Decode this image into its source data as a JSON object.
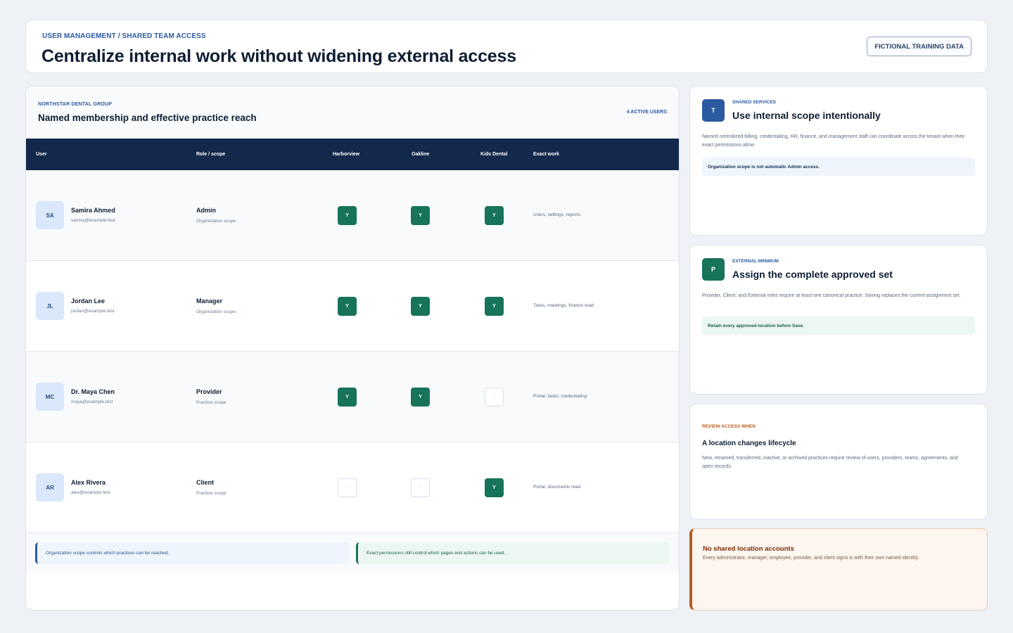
{
  "header": {
    "breadcrumb": "USER MANAGEMENT / SHARED TEAM ACCESS",
    "title": "Centralize internal work without widening external access",
    "badge": "FICTIONAL TRAINING DATA"
  },
  "main": {
    "org": "NORTHSTAR DENTAL GROUP",
    "title": "Named membership and effective practice reach",
    "active_users": "4 ACTIVE USERS",
    "columns": [
      "User",
      "Role / scope",
      "Harborview",
      "Oakline",
      "Kids Dental",
      "Exact work"
    ],
    "rows": [
      {
        "initials": "SA",
        "name": "Samira Ahmed",
        "email": "samira@example.test",
        "role": "Admin",
        "scope": "Organization scope",
        "harborview": "Y",
        "oakline": "Y",
        "kids": "Y",
        "work": "Users, settings, reports"
      },
      {
        "initials": "JL",
        "name": "Jordan Lee",
        "email": "jordan@example.test",
        "role": "Manager",
        "scope": "Organization scope",
        "harborview": "Y",
        "oakline": "Y",
        "kids": "Y",
        "work": "Tasks, meetings, finance read"
      },
      {
        "initials": "MC",
        "name": "Dr. Maya Chen",
        "email": "maya@example.test",
        "role": "Provider",
        "scope": "Practice scope",
        "harborview": "Y",
        "oakline": "Y",
        "kids": "-",
        "work": "Portal, tasks, credentialing"
      },
      {
        "initials": "AR",
        "name": "Alex Rivera",
        "email": "alex@example.test",
        "role": "Client",
        "scope": "Practice scope",
        "harborview": "-",
        "oakline": "-",
        "kids": "Y",
        "work": "Portal, documents read"
      }
    ],
    "notes": {
      "scope": "Organization scope controls which practices can be reached.",
      "permissions": "Exact permissions still control which pages and actions can be used."
    }
  },
  "cards": {
    "shared": {
      "icon": "T",
      "eyebrow": "SHARED SERVICES",
      "title": "Use internal scope intentionally",
      "desc": "Named centralized billing, credentialing, HR, finance, and management staff can coordinate across the tenant when their exact permissions allow.",
      "tip": "Organization scope is not automatic Admin access."
    },
    "external": {
      "icon": "P",
      "eyebrow": "EXTERNAL MINIMUM",
      "title": "Assign the complete approved set",
      "desc": "Provider, Client, and External roles require at least one canonical practice. Saving replaces the current assignment set.",
      "tip": "Retain every approved location before Save."
    },
    "review": {
      "eyebrow": "REVIEW ACCESS WHEN",
      "title": "A location changes lifecycle",
      "desc": "New, renamed, transferred, inactive, or archived practices require review of users, providers, teams, agreements, and open records."
    },
    "warning": {
      "title": "No shared location accounts",
      "desc": "Every administrator, manager, employee, provider, and client signs in with their own named identity."
    }
  },
  "colors": {
    "accent_blue": "#2b5aa0",
    "table_header": "#13294b",
    "access_green": "#17735a",
    "warning_orange": "#b85a1f"
  }
}
